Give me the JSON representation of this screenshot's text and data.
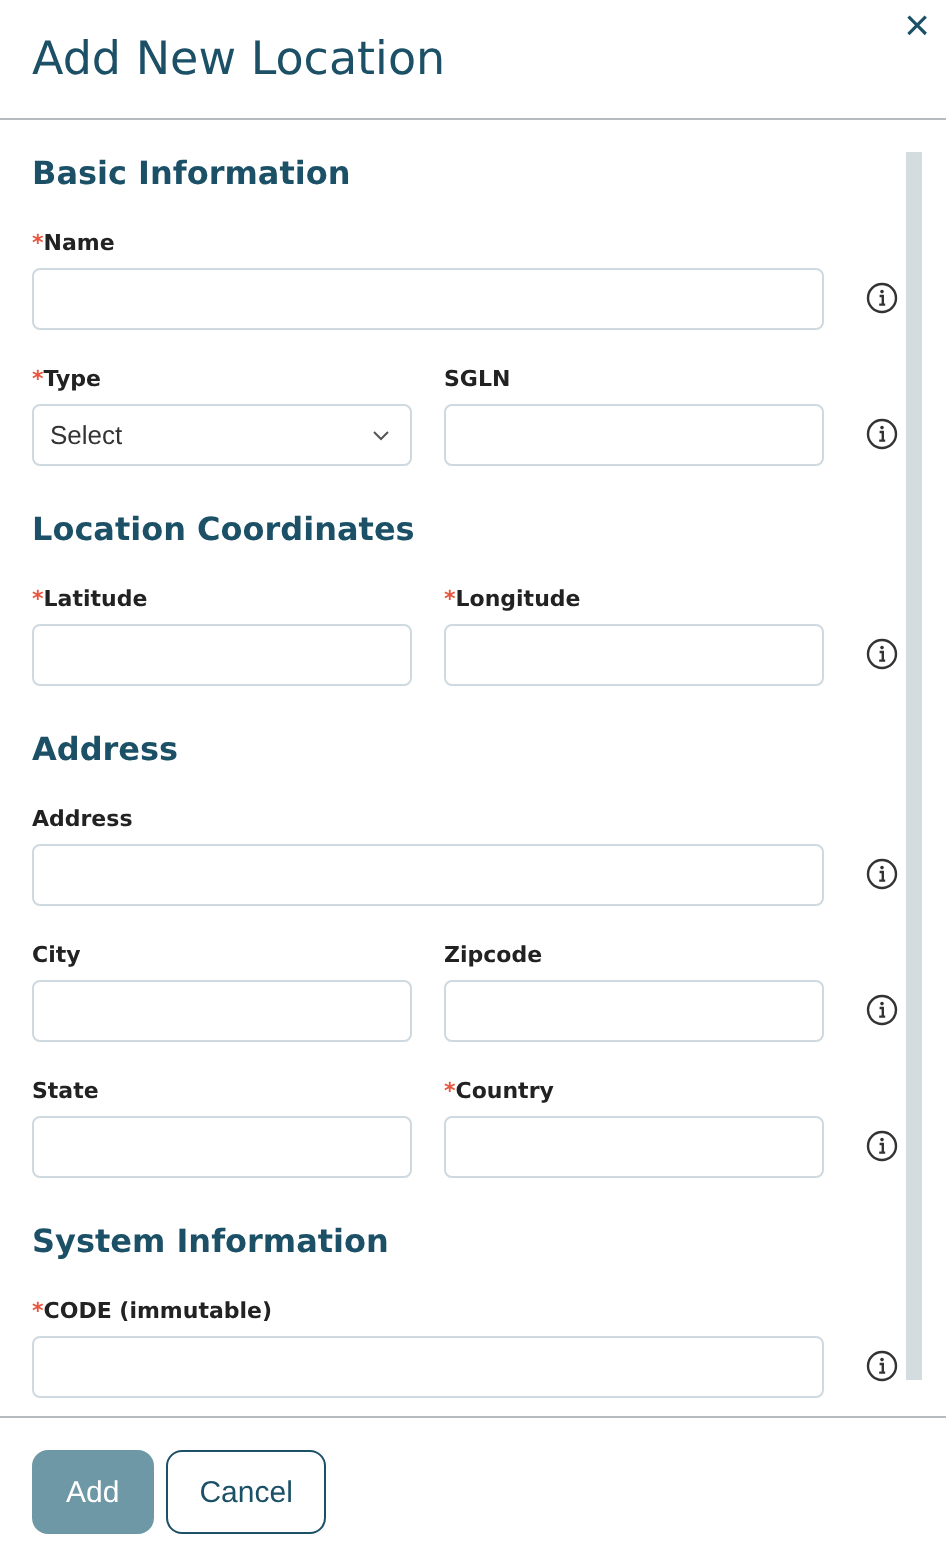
{
  "dialog": {
    "title": "Add New Location",
    "close": "×"
  },
  "sections": [
    {
      "title": "Basic Information",
      "rows": [
        {
          "fields": [
            {
              "label": "Name",
              "required_mark": "*",
              "kind": "text"
            }
          ]
        },
        {
          "fields": [
            {
              "label": "Type",
              "required_mark": "*",
              "kind": "select",
              "value": "Select"
            },
            {
              "label": "SGLN",
              "kind": "text"
            }
          ]
        }
      ]
    },
    {
      "title": "Location Coordinates",
      "rows": [
        {
          "fields": [
            {
              "label": "Latitude",
              "required_mark": "*",
              "kind": "text"
            },
            {
              "label": "Longitude",
              "required_mark": "*",
              "kind": "text"
            }
          ]
        }
      ]
    },
    {
      "title": "Address",
      "rows": [
        {
          "fields": [
            {
              "label": "Address",
              "kind": "text"
            }
          ]
        },
        {
          "fields": [
            {
              "label": "City",
              "kind": "text"
            },
            {
              "label": "Zipcode",
              "kind": "text"
            }
          ]
        },
        {
          "fields": [
            {
              "label": "State",
              "kind": "text"
            },
            {
              "label": "Country",
              "required_mark": "*",
              "kind": "text"
            }
          ]
        }
      ]
    },
    {
      "title": "System Information",
      "rows": [
        {
          "fields": [
            {
              "label": "CODE (immutable)",
              "required_mark": "*",
              "kind": "text"
            }
          ]
        }
      ]
    }
  ],
  "buttons": [
    {
      "label": "Add",
      "kind": "primary",
      "disabled": true
    },
    {
      "label": "Cancel",
      "kind": "secondary",
      "disabled": false
    }
  ]
}
